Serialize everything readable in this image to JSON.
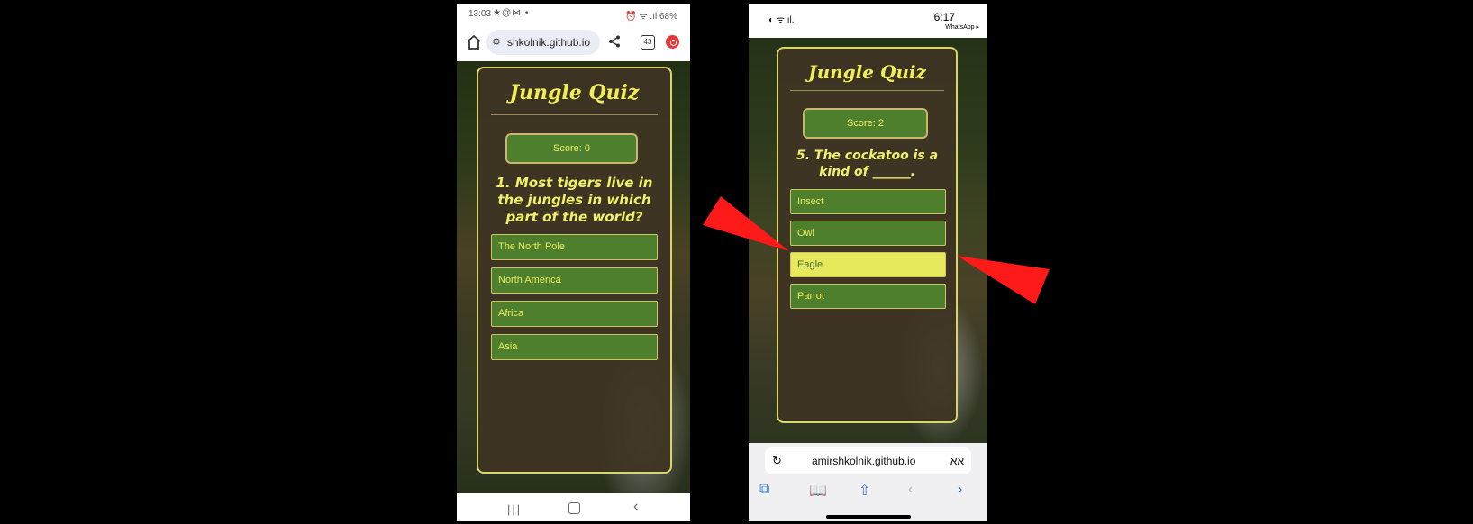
{
  "android": {
    "status": {
      "time": "13:03",
      "left_icons": "★@⋈ •",
      "right": "⏰ ᯤ .ıl 68%"
    },
    "url": "shkolnik.github.io",
    "tab_count": "43",
    "quiz": {
      "title": "Jungle Quiz",
      "score_label": "Score: 0",
      "question": "1. Most tigers live in the jungles in which part of the world?",
      "answers": [
        "The North Pole",
        "North America",
        "Africa",
        "Asia"
      ]
    }
  },
  "ios": {
    "status": {
      "time": "6:17",
      "back_app": "WhatsApp ▸"
    },
    "url": "amirshkolnik.github.io",
    "reader_label": "אא",
    "quiz": {
      "title": "Jungle Quiz",
      "score_label": "Score: 2",
      "question": "5. The cockatoo is a kind of ______.",
      "answers": [
        "Insect",
        "Owl",
        "Eagle",
        "Parrot"
      ],
      "selected_answer": "Eagle"
    }
  },
  "colors": {
    "card_border": "#d9d667",
    "button_green": "#4d7f2c",
    "accent_yellow": "#f0ee58",
    "selected_answer": "#e7e95c",
    "arrow_red": "#ff1a1a"
  }
}
